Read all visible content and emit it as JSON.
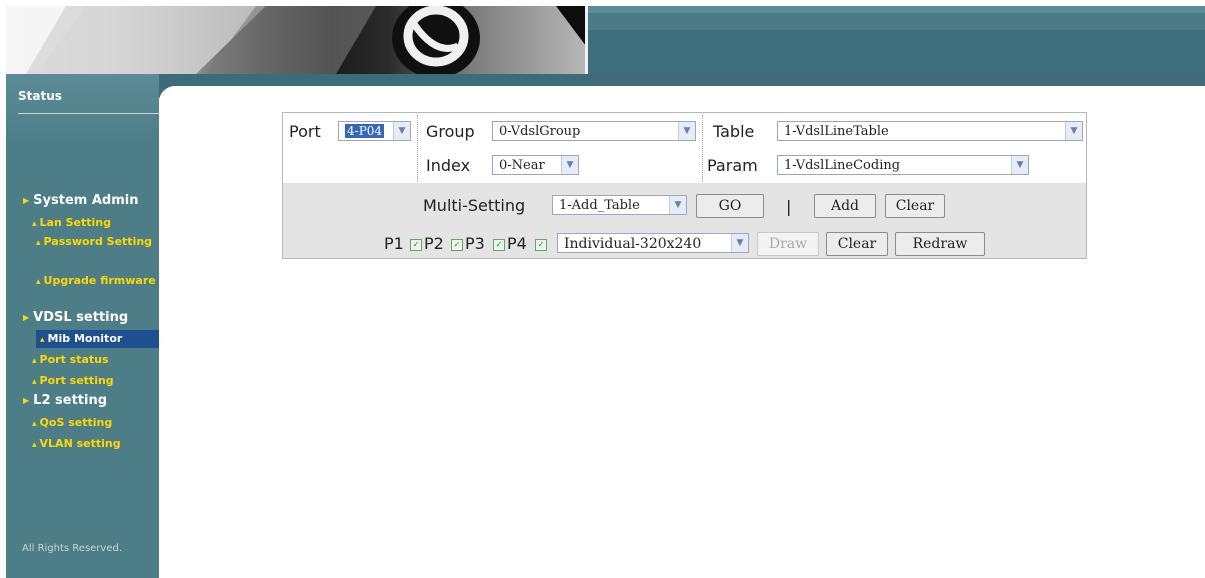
{
  "sidebar": {
    "title": "Status",
    "items": [
      {
        "label": "System Admin",
        "level": "top"
      },
      {
        "label": "Lan Setting",
        "level": "sub"
      },
      {
        "label": "Password Setting",
        "level": "sub"
      },
      {
        "label": "Upgrade firmware",
        "level": "sub"
      },
      {
        "label": "VDSL setting",
        "level": "top"
      },
      {
        "label": "Mib Monitor",
        "level": "sub",
        "active": true
      },
      {
        "label": "Port status",
        "level": "sub"
      },
      {
        "label": "Port setting",
        "level": "sub"
      },
      {
        "label": "L2 setting",
        "level": "top"
      },
      {
        "label": "QoS setting",
        "level": "sub"
      },
      {
        "label": "VLAN setting",
        "level": "sub"
      }
    ],
    "footer": "All Rights Reserved."
  },
  "form": {
    "port": {
      "label": "Port",
      "value": "4-P04"
    },
    "group": {
      "label": "Group",
      "value": "0-VdslGroup"
    },
    "table": {
      "label": "Table",
      "value": "1-VdslLineTable"
    },
    "index": {
      "label": "Index",
      "value": "0-Near"
    },
    "param": {
      "label": "Param",
      "value": "1-VdslLineCoding"
    },
    "multi": {
      "label": "Multi-Setting",
      "value": "1-Add_Table"
    },
    "go_label": "GO",
    "separator": "|",
    "add_label": "Add",
    "clear_label": "Clear",
    "ports": [
      {
        "label": "P1",
        "checked": true
      },
      {
        "label": "P2",
        "checked": true
      },
      {
        "label": "P3",
        "checked": true
      },
      {
        "label": "P4",
        "checked": true
      }
    ],
    "view": {
      "value": "Individual-320x240"
    },
    "draw_label": "Draw",
    "clear2_label": "Clear",
    "redraw_label": "Redraw"
  },
  "colors": {
    "sidebar_bg": "#4d7d87",
    "nav_sub": "#ffd800",
    "active_bg": "#1e4f8f",
    "banner_bg": "#3f6b78"
  }
}
